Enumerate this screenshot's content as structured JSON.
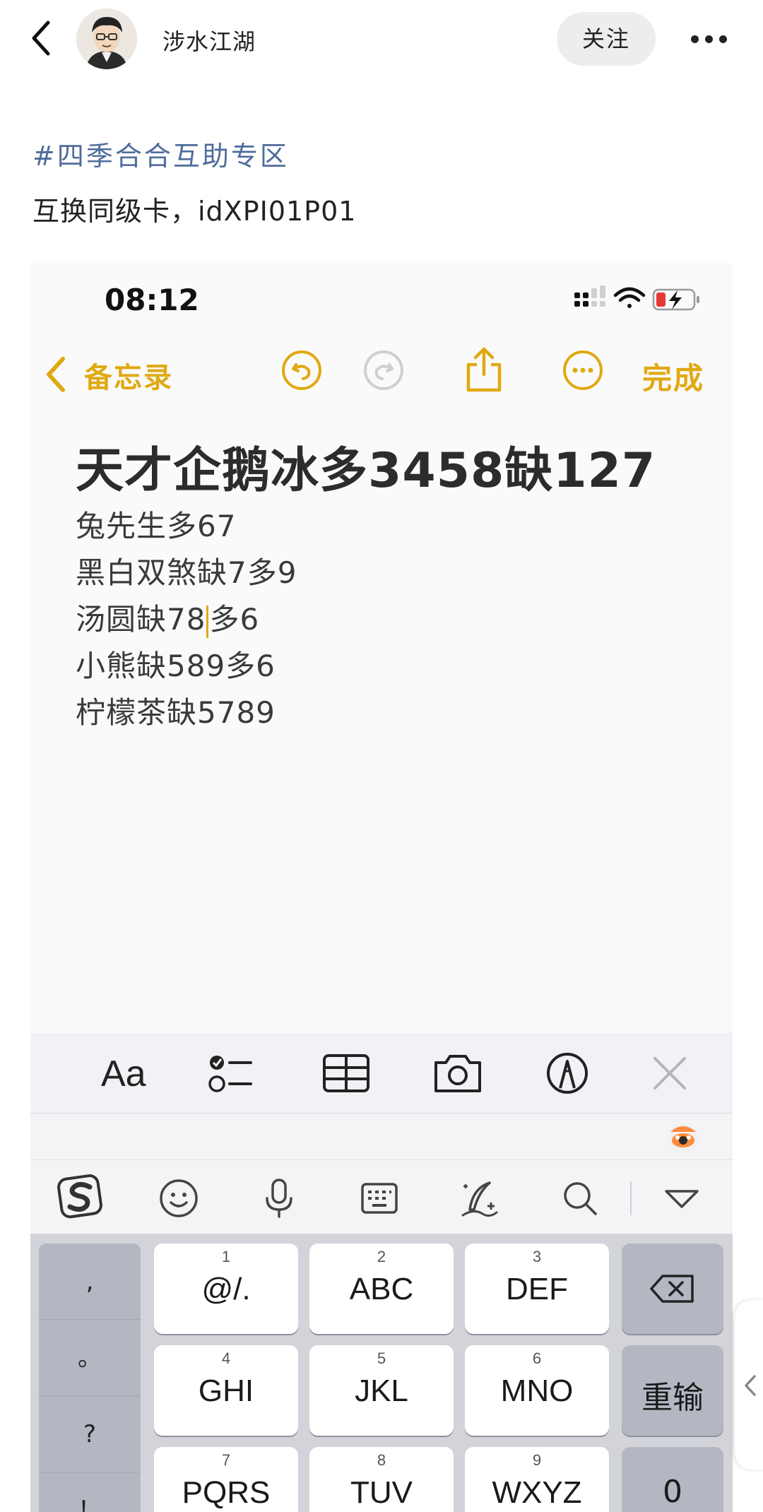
{
  "header": {
    "author_name": "涉水江湖",
    "follow_label": "关注"
  },
  "post": {
    "topic_tag": "#四季合合互助专区",
    "text": "互换同级卡，idXPI01P01"
  },
  "screenshot": {
    "status_time": "08:12",
    "nav": {
      "back_label": "备忘录",
      "done_label": "完成"
    },
    "note": {
      "title": "天才企鹅冰多3458缺127",
      "lines": [
        "兔先生多67",
        "黑白双煞缺7多9",
        "汤圆缺78",
        "多6",
        "小熊缺589多6",
        "柠檬茶缺5789"
      ]
    },
    "format_bar": {
      "aa_label": "Aa"
    },
    "keyboard": {
      "side_keys": [
        ",",
        "。",
        "?",
        "！"
      ],
      "keys": [
        {
          "num": "1",
          "label": "@/."
        },
        {
          "num": "2",
          "label": "ABC"
        },
        {
          "num": "3",
          "label": "DEF"
        },
        {
          "num": "4",
          "label": "GHI"
        },
        {
          "num": "5",
          "label": "JKL"
        },
        {
          "num": "6",
          "label": "MNO"
        },
        {
          "num": "7",
          "label": "PQRS"
        },
        {
          "num": "8",
          "label": "TUV"
        },
        {
          "num": "9",
          "label": "WXYZ"
        }
      ],
      "reset_label": "重输",
      "zero_label": "0"
    }
  },
  "colors": {
    "accent": "#e0a912",
    "topic_link": "#4f6c9a",
    "battery_low": "#e53935"
  },
  "icons": [
    "back-chevron-icon",
    "more-icon",
    "undo-icon",
    "redo-icon",
    "share-icon",
    "more-circle-icon",
    "checklist-icon",
    "table-icon",
    "camera-icon",
    "markup-icon",
    "close-icon",
    "sogou-icon",
    "emoji-icon",
    "mic-icon",
    "keyboard-icon",
    "handwriting-icon",
    "search-icon",
    "collapse-icon",
    "delete-icon"
  ]
}
